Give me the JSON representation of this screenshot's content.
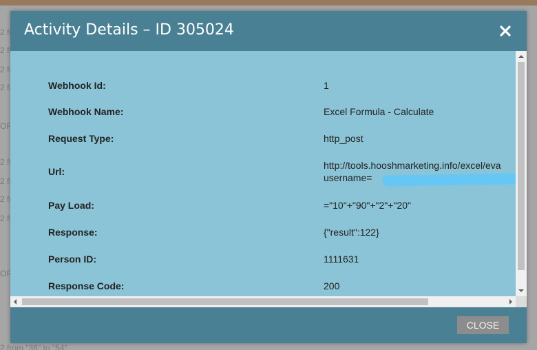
{
  "background": {
    "lines": [
      "2 fr",
      "2 fr",
      "2 fr",
      "2 fr",
      "OR",
      "2 fr",
      "2 fr",
      "2 fr",
      "2 fr",
      "OR",
      "2 from \"36\" to \"54\""
    ]
  },
  "modal": {
    "title": "Activity Details – ID 305024",
    "close_label": "CLOSE"
  },
  "details": [
    {
      "label": "Webhook Id:",
      "value": "1"
    },
    {
      "label": "Webhook Name:",
      "value": "Excel Formula - Calculate"
    },
    {
      "label": "Request Type:",
      "value": "http_post"
    },
    {
      "label": "Url:",
      "value": "http://tools.hooshmarketing.info/excel/eva",
      "value_line2": "username="
    },
    {
      "label": "Pay Load:",
      "value": "=\"10\"+\"90\"+\"2\"+\"20\""
    },
    {
      "label": "Response:",
      "value": "{\"result\":122}"
    },
    {
      "label": "Person ID:",
      "value": "1111631"
    },
    {
      "label": "Response Code:",
      "value": "200"
    }
  ],
  "colors": {
    "header": "#4a8093",
    "body": "#8bc4d6",
    "redaction": "#66c7f5"
  }
}
